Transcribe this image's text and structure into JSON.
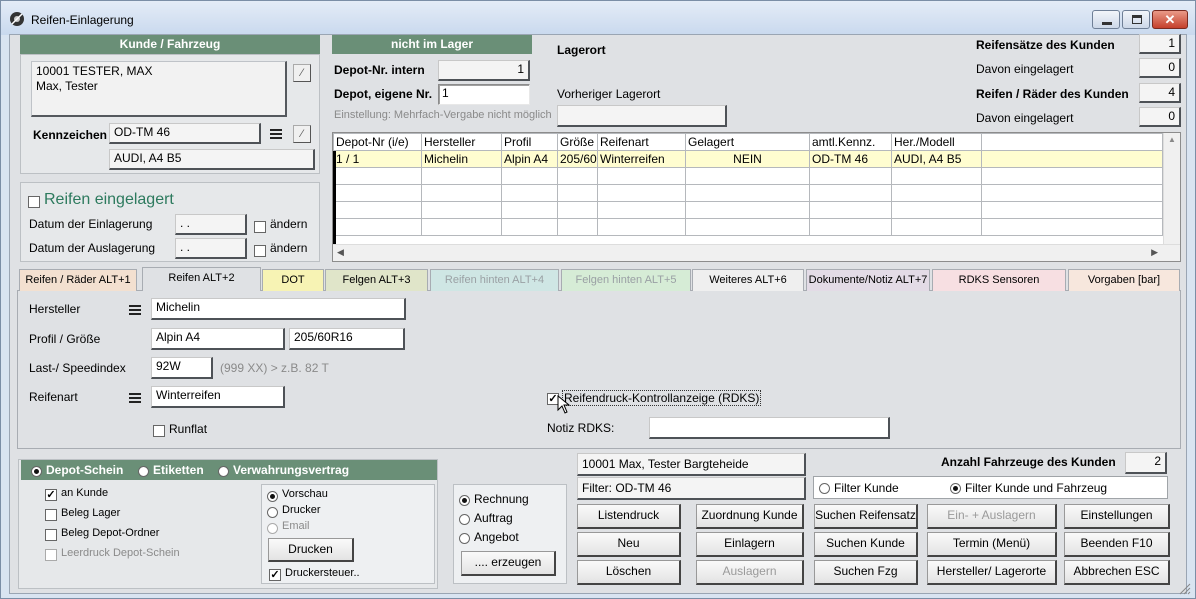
{
  "window": {
    "title": "Reifen-Einlagerung"
  },
  "customer": {
    "header": "Kunde / Fahrzeug",
    "address_line1": "10001 TESTER, MAX",
    "address_line2": "Max, Tester",
    "plate_label": "Kennzeichen",
    "plate_value": "OD-TM 46",
    "vehicle_value": "AUDI, A4 B5"
  },
  "storage": {
    "checkbox_label": "Reifen eingelagert",
    "date_in_label": "Datum der Einlagerung",
    "date_in_value": ". .",
    "date_out_label": "Datum der Auslagerung",
    "date_out_value": ". .",
    "change_label": "ändern"
  },
  "depot": {
    "header": "nicht im Lager",
    "internal_label": "Depot-Nr. intern",
    "internal_value": "1",
    "own_label": "Depot, eigene Nr.",
    "own_value": "1",
    "hint": "Einstellung: Mehrfach-Vergabe nicht möglich",
    "location_label": "Lagerort",
    "prev_location_label": "Vorheriger Lagerort"
  },
  "stats": {
    "sets_label": "Reifensätze des Kunden",
    "sets_value": "1",
    "sets_stored_label": "Davon eingelagert",
    "sets_stored_value": "0",
    "wheels_label": "Reifen / Räder des Kunden",
    "wheels_value": "4",
    "wheels_stored_label": "Davon eingelagert",
    "wheels_stored_value": "0"
  },
  "table": {
    "columns": [
      "Depot-Nr (i/e)",
      "Hersteller",
      "Profil",
      "Größe",
      "Reifenart",
      "Gelagert",
      "amtl.Kennz.",
      "Her./Modell"
    ],
    "rows": [
      [
        "1 / 1",
        "Michelin",
        "Alpin A4",
        "205/60",
        "Winterreifen",
        "NEIN",
        "OD-TM 46",
        "AUDI, A4 B5"
      ]
    ]
  },
  "tabs": [
    {
      "label": "Reifen / Räder ALT+1",
      "color": "#f3e0d0"
    },
    {
      "label": "Reifen ALT+2",
      "color": "#dfe1e4"
    },
    {
      "label": "DOT",
      "color": "#f7f3b4"
    },
    {
      "label": "Felgen ALT+3",
      "color": "#e0e5c9"
    },
    {
      "label": "Reifen hinten ALT+4",
      "color": "#cfe6e4"
    },
    {
      "label": "Felgen hinten ALT+5",
      "color": "#d6ecd6"
    },
    {
      "label": "Weiteres ALT+6",
      "color": "#efefef"
    },
    {
      "label": "Dokumente/Notiz ALT+7",
      "color": "#e3dbe6"
    },
    {
      "label": "RDKS Sensoren",
      "color": "#f7dfe2"
    },
    {
      "label": "Vorgaben [bar]",
      "color": "#f7e7dd"
    }
  ],
  "tire": {
    "maker_label": "Hersteller",
    "maker_value": "Michelin",
    "profile_label": "Profil / Größe",
    "profile_value": "Alpin A4",
    "size_value": "205/60R16",
    "index_label": "Last-/ Speedindex",
    "index_value": "92W",
    "index_hint": "(999 XX) > z.B. 82 T",
    "type_label": "Reifenart",
    "type_value": "Winterreifen",
    "runflat_label": "Runflat",
    "rdks_label": "Reifendruck-Kontrollanzeige (RDKS)",
    "rdks_note_label": "Notiz RDKS:"
  },
  "print": {
    "opt_depot": "Depot-Schein",
    "opt_labels": "Etiketten",
    "opt_contract": "Verwahrungsvertrag",
    "to_customer": "an Kunde",
    "doc_store": "Beleg Lager",
    "doc_folder": "Beleg Depot-Ordner",
    "blank": "Leerdruck Depot-Schein",
    "preview": "Vorschau",
    "printer": "Drucker",
    "email": "Email",
    "print_btn": "Drucken",
    "print_ctrl": "Druckersteuer..",
    "invoice": "Rechnung",
    "order": "Auftrag",
    "offer": "Angebot",
    "create_btn": ".... erzeugen"
  },
  "filter": {
    "customer_display": "10001 Max, Tester Bargteheide",
    "filter_display": "Filter: OD-TM 46",
    "vehicles_label": "Anzahl Fahrzeuge des Kunden",
    "vehicles_value": "2",
    "opt_customer": "Filter Kunde",
    "opt_customer_vehicle": "Filter Kunde und Fahrzeug"
  },
  "buttons": {
    "list_print": "Listendruck",
    "assign_customer": "Zuordnung Kunde",
    "find_set": "Suchen Reifensatz",
    "in_out": "Ein- + Auslagern",
    "settings": "Einstellungen",
    "new": "Neu",
    "store": "Einlagern",
    "find_customer": "Suchen Kunde",
    "appointment": "Termin (Menü)",
    "quit": "Beenden F10",
    "delete": "Löschen",
    "retrieve": "Auslagern",
    "find_vehicle": "Suchen Fzg",
    "maker_location": "Hersteller/ Lagerorte",
    "cancel": "Abbrechen ESC"
  }
}
